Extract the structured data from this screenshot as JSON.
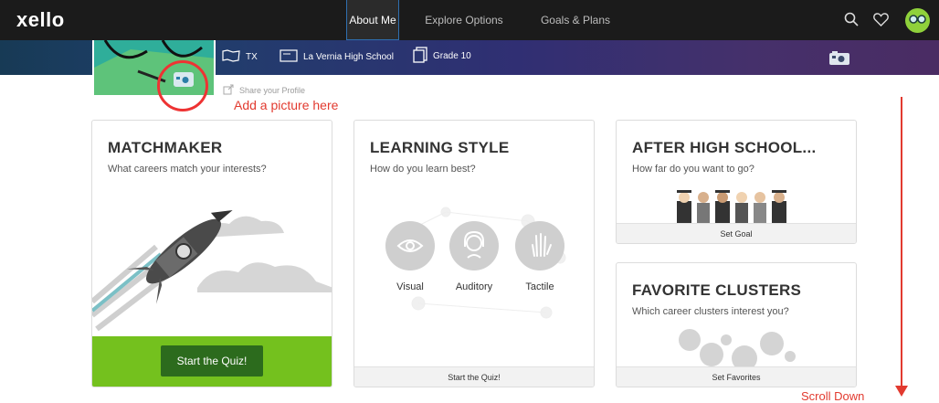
{
  "nav": {
    "logo": "xello",
    "tabs": [
      {
        "label": "About Me",
        "active": true
      },
      {
        "label": "Explore Options",
        "active": false
      },
      {
        "label": "Goals & Plans",
        "active": false
      }
    ],
    "icons": [
      "search-icon",
      "heart-icon",
      "avatar"
    ]
  },
  "profile": {
    "state": "TX",
    "school": "La Vernia High School",
    "grade": "Grade 10",
    "share_link": "Share your Profile"
  },
  "annotations": {
    "add_picture": "Add a picture here",
    "scroll_down": "Scroll Down"
  },
  "cards": {
    "matchmaker": {
      "title": "MATCHMAKER",
      "subtitle": "What careers match your interests?",
      "button": "Start the Quiz!"
    },
    "learning_style": {
      "title": "LEARNING STYLE",
      "subtitle": "How do you learn best?",
      "styles": [
        "Visual",
        "Auditory",
        "Tactile"
      ],
      "footer": "Start the Quiz!"
    },
    "after_high_school": {
      "title": "AFTER HIGH SCHOOL...",
      "subtitle": "How far do you want to go?",
      "footer": "Set Goal"
    },
    "favorite_clusters": {
      "title": "FAVORITE CLUSTERS",
      "subtitle": "Which career clusters interest you?",
      "footer": "Set Favorites"
    }
  },
  "colors": {
    "nav_bg": "#1b1b1b",
    "quiz_green": "#74c11e",
    "quiz_button": "#2c6b1d",
    "annotation_red": "#e23a2f"
  }
}
